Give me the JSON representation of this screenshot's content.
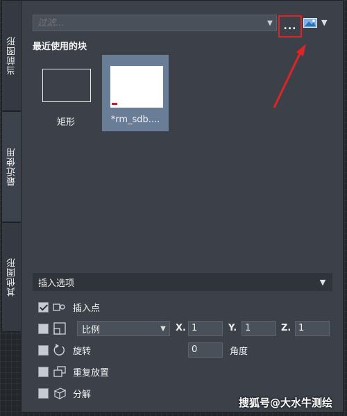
{
  "tabs": [
    {
      "label": "当前图形",
      "active": false
    },
    {
      "label": "最近使用",
      "active": true
    },
    {
      "label": "其他图形",
      "active": false
    }
  ],
  "filter": {
    "placeholder": "过滤..."
  },
  "more_button": {
    "label": "..."
  },
  "section_title": "最近使用的块",
  "blocks": [
    {
      "label": "矩形",
      "selected": false
    },
    {
      "label": "*rm_sdb....",
      "selected": true
    }
  ],
  "insert_options": {
    "title": "插入选项",
    "insertion_point": {
      "label": "插入点",
      "checked": true
    },
    "scale": {
      "checked": false,
      "mode": "比例",
      "x_label": "X.",
      "x_value": "1",
      "y_label": "Y.",
      "y_value": "1",
      "z_label": "Z.",
      "z_value": "1"
    },
    "rotation": {
      "label": "旋转",
      "checked": false,
      "value": "0",
      "unit_label": "角度"
    },
    "repeat": {
      "label": "重复放置",
      "checked": false
    },
    "explode": {
      "label": "分解",
      "checked": false
    }
  },
  "watermark": "搜狐号@大水牛测绘",
  "colors": {
    "accent_red": "#e02424",
    "selected_block": "#6a7d97"
  }
}
